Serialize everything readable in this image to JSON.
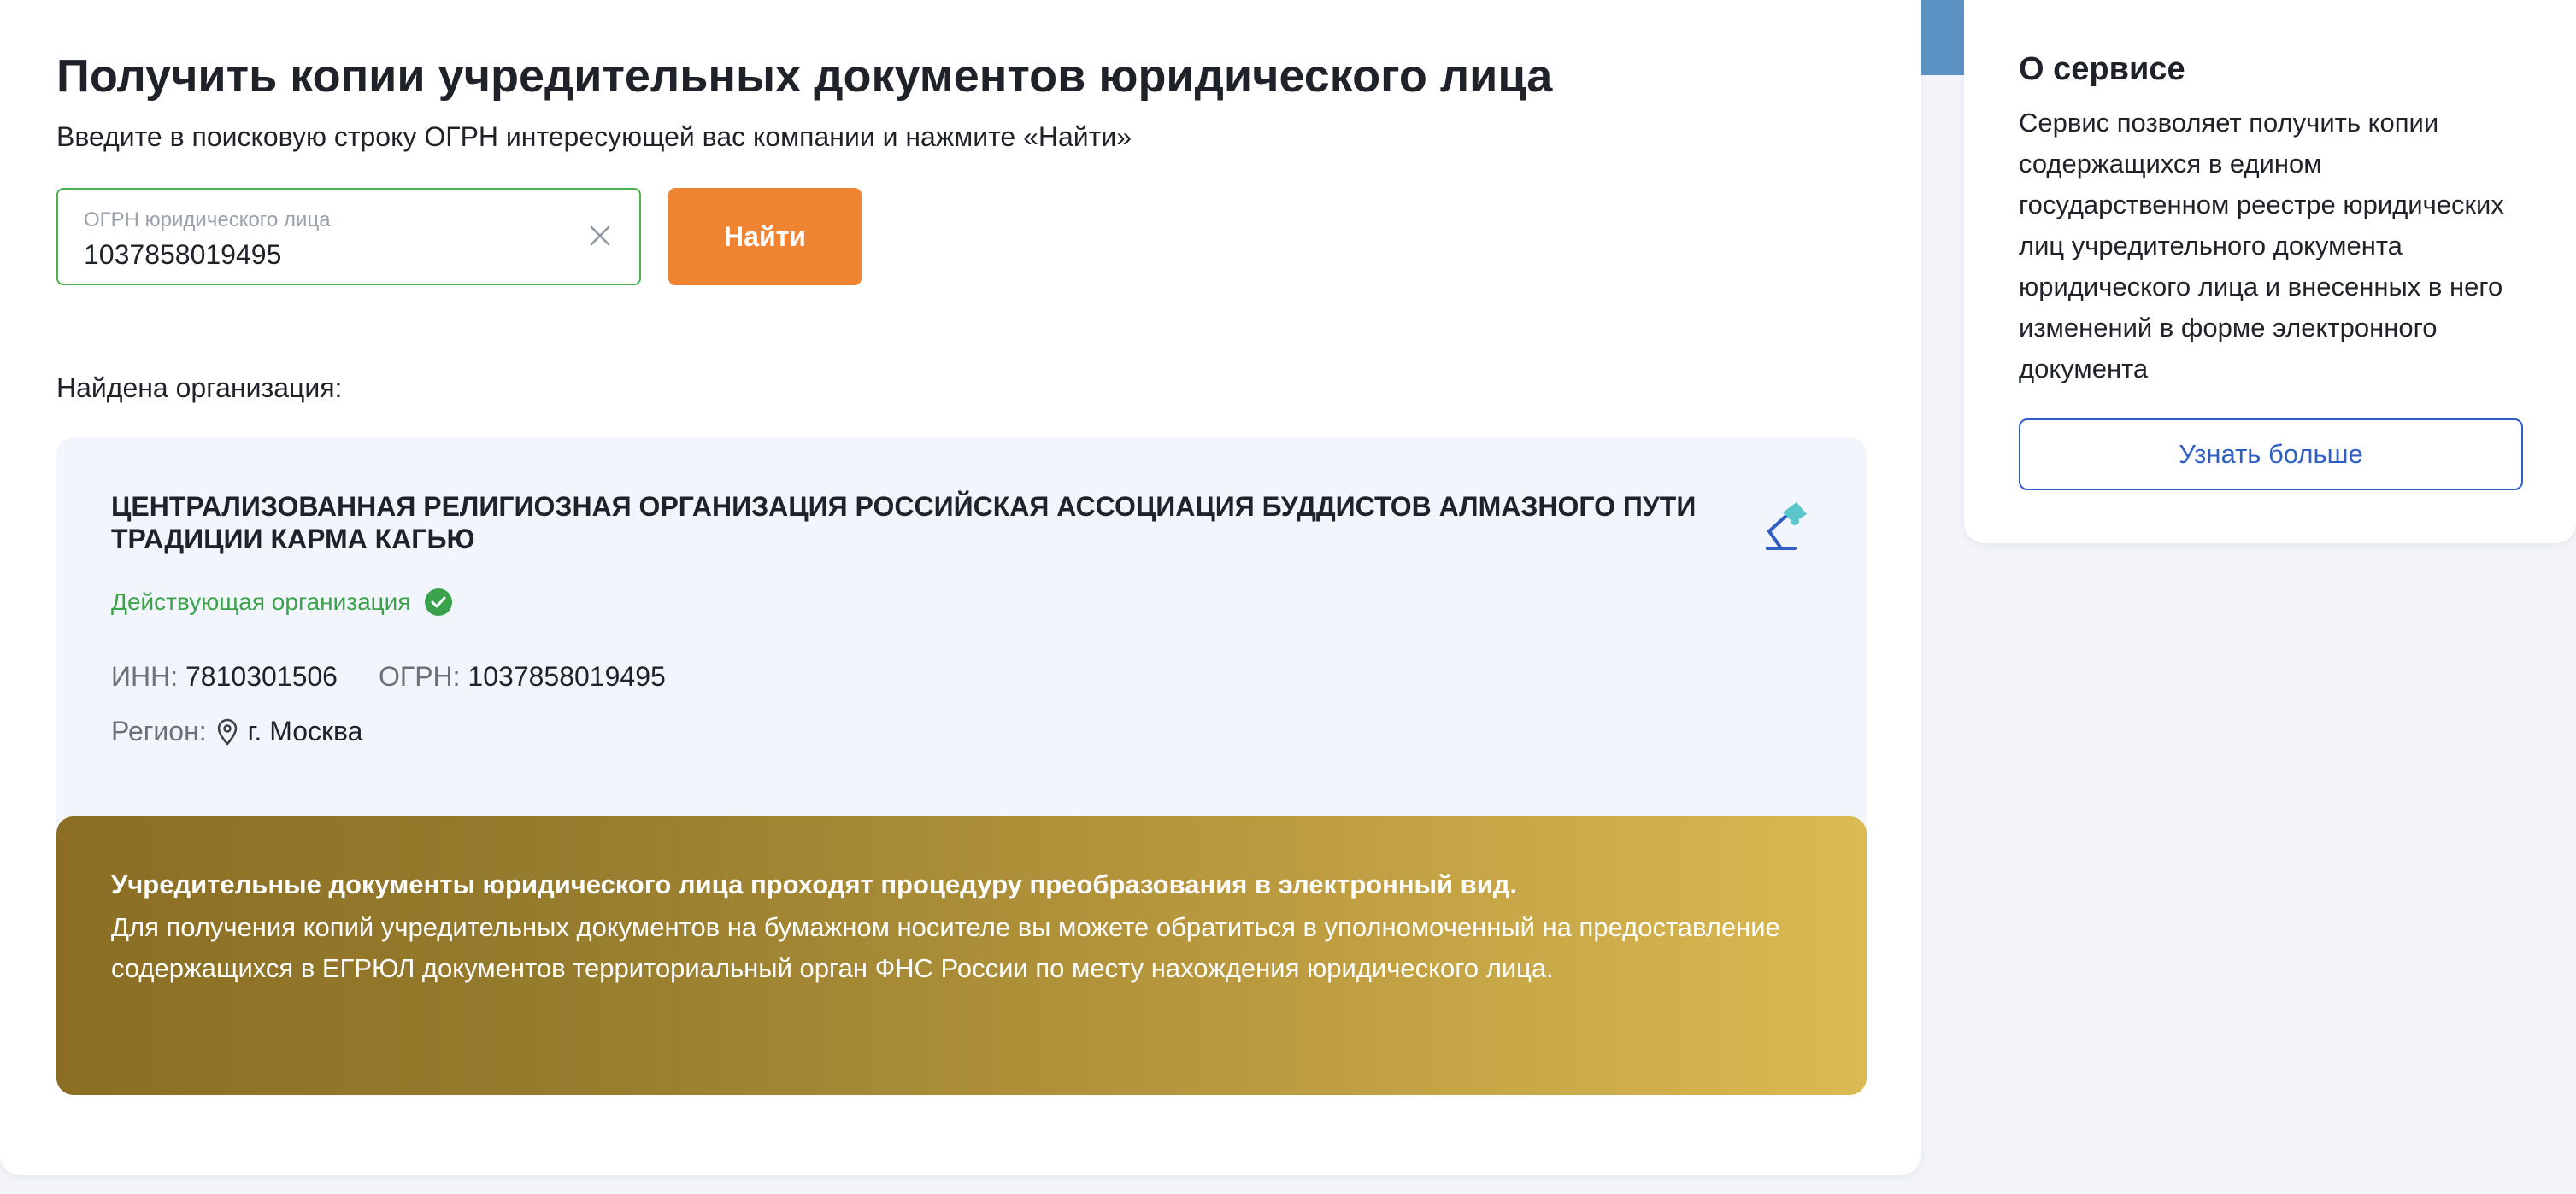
{
  "main": {
    "title": "Получить копии учредительных документов юридического лица",
    "subtitle": "Введите в поисковую строку ОГРН интересующей вас компании и нажмите «Найти»",
    "search": {
      "label": "ОГРН юридического лица",
      "value": "1037858019495",
      "clear_icon": "close-icon"
    },
    "find_button": "Найти",
    "found_label": "Найдена организация:",
    "organization": {
      "name": "ЦЕНТРАЛИЗОВАННАЯ РЕЛИГИОЗНАЯ ОРГАНИЗАЦИЯ РОССИЙСКАЯ АССОЦИАЦИЯ БУДДИСТОВ АЛМАЗНОГО ПУТИ ТРАДИЦИИ КАРМА КАГЬЮ",
      "status": "Действующая организация",
      "status_color": "#3aa24a",
      "inn_label": "ИНН:",
      "inn": "7810301506",
      "ogrn_label": "ОГРН:",
      "ogrn": "1037858019495",
      "region_label": "Регион:",
      "region": "г. Москва"
    },
    "notice": {
      "title": "Учредительные документы юридического лица проходят процедуру преобразования в электронный вид.",
      "text": "Для получения копий учредительных документов на бумажном носителе вы можете обратиться в уполномоченный на предоставление содержащихся в ЕГРЮЛ документов территориальный орган ФНС России по месту нахождения юридического лица."
    }
  },
  "sidebar": {
    "title": "О сервисе",
    "text": "Сервис позволяет получить копии содержащихся в едином государственном реестре юридических лиц учредительного документа юридического лица и внесенных в него изменений в форме электронного документа",
    "more_button": "Узнать больше"
  },
  "colors": {
    "accent_orange": "#ef8533",
    "link_blue": "#2f5fc4",
    "success_green": "#3aa24a",
    "header_blue": "#5b93c5"
  }
}
